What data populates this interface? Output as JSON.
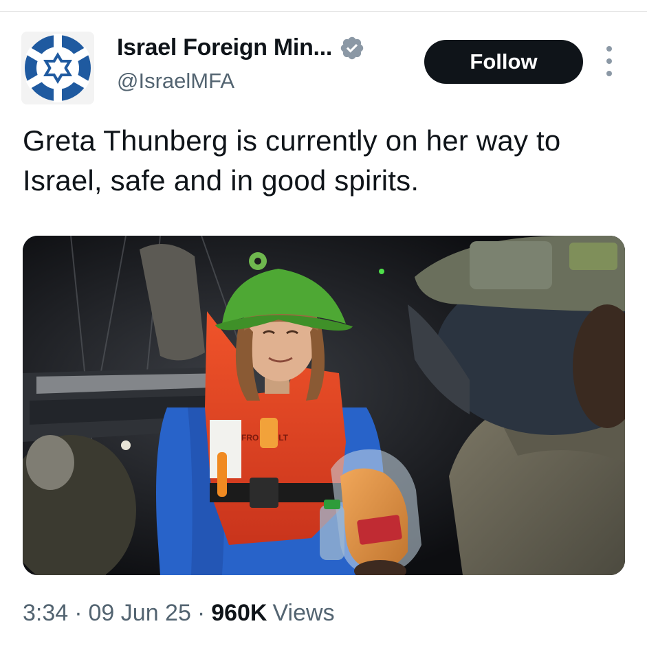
{
  "account": {
    "display_name": "Israel Foreign Min...",
    "handle": "@IsraelMFA",
    "verified": true,
    "verified_badge_color": "#8b98a5"
  },
  "actions": {
    "follow_label": "Follow",
    "more_icon": "more-vertical-icon"
  },
  "tweet": {
    "text": "Greta Thunberg is currently on her way to Israel, safe and in good spirits.",
    "media": {
      "lifejacket_text": "FRO ADULT"
    }
  },
  "meta": {
    "time": "3:34",
    "date": "09 Jun 25",
    "views_count": "960K",
    "views_label": "Views",
    "separator": "·"
  },
  "colors": {
    "logo_blue": "#1f5aa0",
    "follow_bg": "#0f1419",
    "secondary_text": "#536471"
  }
}
